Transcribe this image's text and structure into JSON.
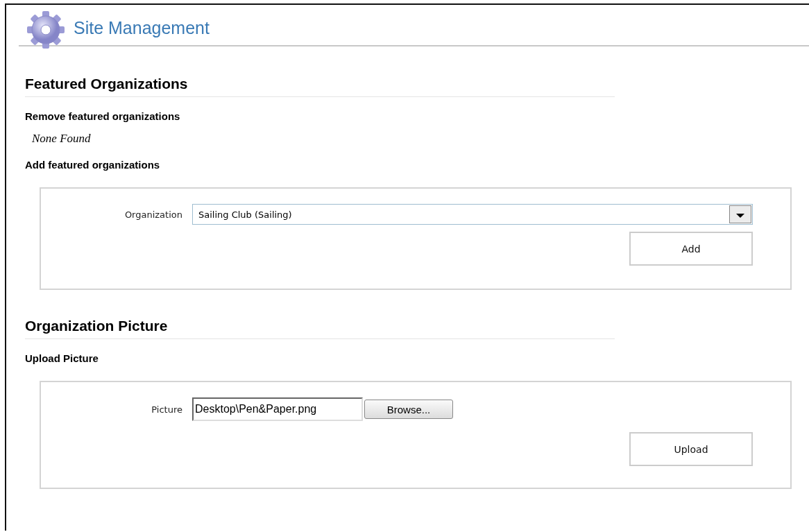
{
  "header": {
    "title": "Site Management"
  },
  "sections": [
    {
      "heading": "Featured Organizations",
      "groups": [
        {
          "title": "Remove featured organizations",
          "empty_text": "None Found"
        },
        {
          "title": "Add featured organizations",
          "form": {
            "kind": "select",
            "label": "Organization",
            "value": "Sailing Club (Sailing)",
            "button": "Add"
          }
        }
      ]
    },
    {
      "heading": "Organization Picture",
      "groups": [
        {
          "title": "Upload Picture",
          "form": {
            "kind": "file",
            "label": "Picture",
            "value": "Desktop\\Pen&Paper.png",
            "browse": "Browse...",
            "button": "Upload"
          }
        }
      ]
    }
  ]
}
